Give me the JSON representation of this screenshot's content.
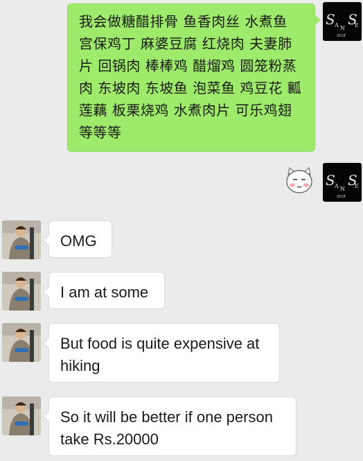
{
  "conversation": {
    "messages": [
      {
        "sender": "self",
        "type": "text",
        "text": "我会做糖醋排骨  鱼香肉丝  水煮鱼 宫保鸡丁 麻婆豆腐 红烧肉 夫妻肺片 回锅肉 棒棒鸡 醋熘鸡 圆笼粉蒸肉 东坡肉 东坡鱼 泡菜鱼 鸡豆花 瓤莲藕 板栗烧鸡 水煮肉片 可乐鸡翅等等等"
      },
      {
        "sender": "self",
        "type": "sticker",
        "sticker": "cat-face-sticker"
      },
      {
        "sender": "contact",
        "type": "text",
        "text": "OMG"
      },
      {
        "sender": "contact",
        "type": "text",
        "text": "I am at some"
      },
      {
        "sender": "contact",
        "type": "text",
        "text": "But food is quite expensive at hiking"
      },
      {
        "sender": "contact",
        "type": "text",
        "text": "So it will be better if one person take Rs.20000"
      }
    ]
  },
  "self_avatar": {
    "signature": "San Se",
    "year": "2018"
  },
  "colors": {
    "background": "#ebebeb",
    "sent_bubble": "#9eea6a",
    "received_bubble": "#ffffff"
  }
}
